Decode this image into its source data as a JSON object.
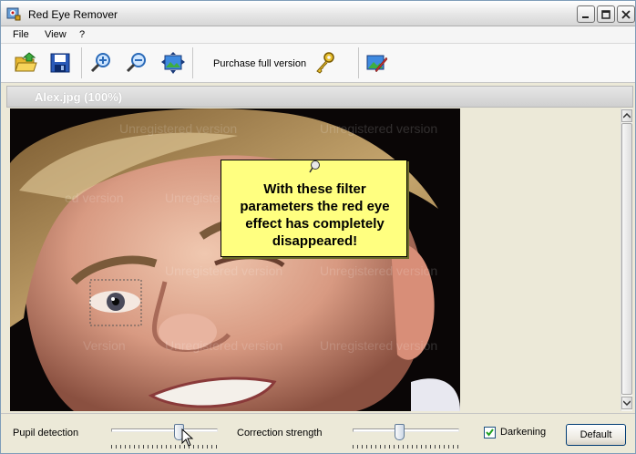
{
  "window": {
    "title": "Red Eye Remover"
  },
  "menu": {
    "file": "File",
    "view": "View",
    "help": "?"
  },
  "toolbar": {
    "buttons": [
      {
        "icon": "open-folder-icon"
      },
      {
        "icon": "save-disk-icon"
      },
      {
        "icon": "zoom-in-icon"
      },
      {
        "icon": "zoom-out-icon"
      },
      {
        "icon": "fit-to-window-icon"
      },
      {
        "icon": "key-icon"
      },
      {
        "icon": "edit-image-icon"
      }
    ],
    "purchase_label": "Purchase full version"
  },
  "document": {
    "title": "Alex.jpg (100%)"
  },
  "image": {
    "watermark_text": "Unregistered version",
    "watermark_partial": "Version",
    "watermark_partial2": "ed version"
  },
  "tooltip": {
    "text": "With these filter parameters the red eye effect has completely disappeared!"
  },
  "controls": {
    "pupil_label": "Pupil detection",
    "pupil_value": 0.65,
    "strength_label": "Correction strength",
    "strength_value": 0.43,
    "darkening_label": "Darkening",
    "darkening_checked": true,
    "default_button": "Default"
  },
  "colors": {
    "tooltip_bg": "#ffff80",
    "window_bg": "#ece9d8"
  }
}
